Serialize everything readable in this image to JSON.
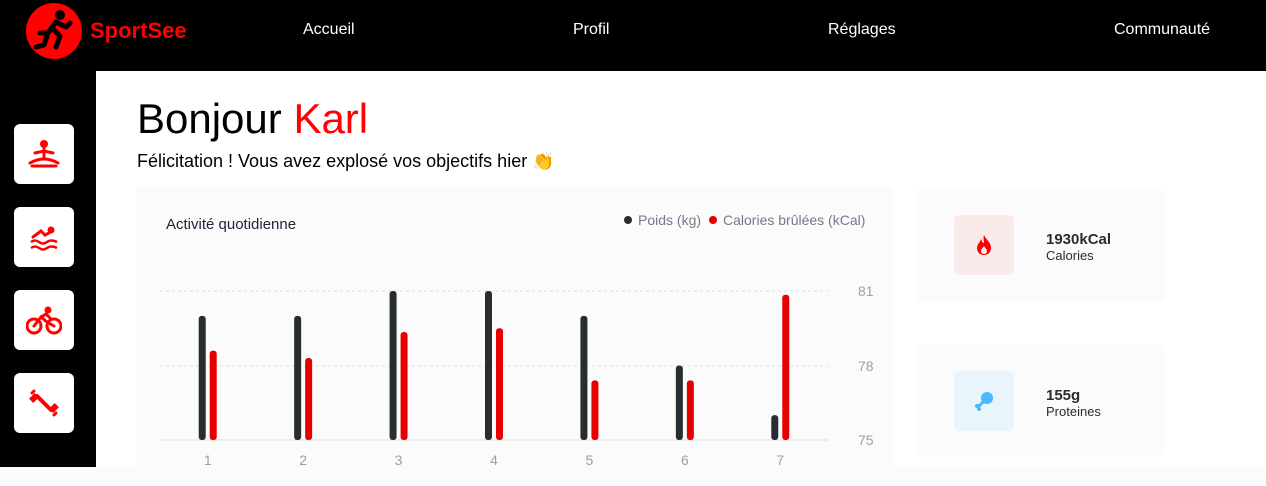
{
  "brand": {
    "name": "SportSee"
  },
  "nav": [
    {
      "label": "Accueil"
    },
    {
      "label": "Profil"
    },
    {
      "label": "Réglages"
    },
    {
      "label": "Communauté"
    }
  ],
  "sidebar": [
    {
      "icon": "yoga-icon"
    },
    {
      "icon": "swimming-icon"
    },
    {
      "icon": "cycling-icon"
    },
    {
      "icon": "dumbbell-icon"
    }
  ],
  "greeting": {
    "hello": "Bonjour",
    "name": "Karl",
    "message": "Félicitation ! Vous avez explosé vos objectifs hier 👏"
  },
  "chart_data": {
    "type": "bar",
    "title": "Activité quotidienne",
    "categories": [
      "1",
      "2",
      "3",
      "4",
      "5",
      "6",
      "7"
    ],
    "series": [
      {
        "name": "Poids (kg)",
        "color": "#282d30",
        "values": [
          80,
          80,
          81,
          81,
          80,
          78,
          76
        ]
      },
      {
        "name": "Calories brûlées (kCal)",
        "color": "#e60000",
        "values": [
          240,
          220,
          290,
          300,
          160,
          160,
          390
        ]
      }
    ],
    "y_ticks": [
      "81",
      "78",
      "75"
    ],
    "ylim": [
      75,
      81
    ],
    "grid": true,
    "legend_position": "top-right"
  },
  "kpis": [
    {
      "value": "1930kCal",
      "label": "Calories",
      "icon": "flame-icon",
      "bg": "#fbeaea",
      "color": "#ff0000"
    },
    {
      "value": "155g",
      "label": "Proteines",
      "icon": "chicken-icon",
      "bg": "#e9f4fb",
      "color": "#4ab8ff"
    }
  ]
}
